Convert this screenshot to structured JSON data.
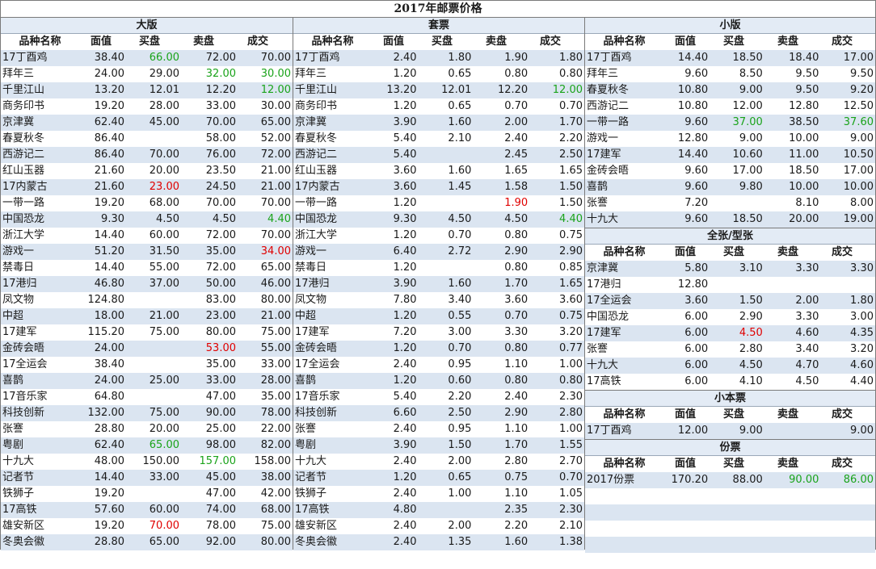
{
  "title": "2017年邮票价格",
  "columns": [
    "品种名称",
    "面值",
    "买盘",
    "卖盘",
    "成交"
  ],
  "colors": {
    "row_alt": "#dbe5f1",
    "header": "#e3ebf5",
    "up": "#1aa31a",
    "down": "#e00000"
  },
  "sections": [
    {
      "key": "dabang",
      "title": "大版",
      "rows": [
        [
          "17丁酉鸡",
          "38.40",
          "66.00",
          "72.00",
          "70.00"
        ],
        [
          "拜年三",
          "24.00",
          "29.00",
          "32.00",
          "30.00"
        ],
        [
          "千里江山",
          "13.20",
          "12.01",
          "12.20",
          "12.00"
        ],
        [
          "商务印书",
          "19.20",
          "28.00",
          "33.00",
          "30.00"
        ],
        [
          "京津冀",
          "62.40",
          "45.00",
          "70.00",
          "65.00"
        ],
        [
          "春夏秋冬",
          "86.40",
          "",
          "58.00",
          "52.00"
        ],
        [
          "西游记二",
          "86.40",
          "70.00",
          "76.00",
          "72.00"
        ],
        [
          "红山玉器",
          "21.60",
          "20.00",
          "23.50",
          "21.00"
        ],
        [
          "17内蒙古",
          "21.60",
          "23.00",
          "24.50",
          "21.00"
        ],
        [
          "一带一路",
          "19.20",
          "68.00",
          "70.00",
          "70.00"
        ],
        [
          "中国恐龙",
          "9.30",
          "4.50",
          "4.50",
          "4.40"
        ],
        [
          "浙江大学",
          "14.40",
          "60.00",
          "72.00",
          "70.00"
        ],
        [
          "游戏一",
          "51.20",
          "31.50",
          "35.00",
          "34.00"
        ],
        [
          "禁毒日",
          "14.40",
          "55.00",
          "72.00",
          "65.00"
        ],
        [
          "17港归",
          "46.80",
          "37.00",
          "50.00",
          "46.00"
        ],
        [
          "凤文物",
          "124.80",
          "",
          "83.00",
          "80.00"
        ],
        [
          "中超",
          "18.00",
          "21.00",
          "23.00",
          "21.00"
        ],
        [
          "17建军",
          "115.20",
          "75.00",
          "80.00",
          "75.00"
        ],
        [
          "金砖会晤",
          "24.00",
          "",
          "53.00",
          "55.00"
        ],
        [
          "17全运会",
          "38.40",
          "",
          "35.00",
          "33.00"
        ],
        [
          "喜鹊",
          "24.00",
          "25.00",
          "33.00",
          "28.00"
        ],
        [
          "17音乐家",
          "64.80",
          "",
          "47.00",
          "35.00"
        ],
        [
          "科技创新",
          "132.00",
          "75.00",
          "90.00",
          "78.00"
        ],
        [
          "张謇",
          "28.80",
          "20.00",
          "25.00",
          "22.00"
        ],
        [
          "粤剧",
          "62.40",
          "65.00",
          "98.00",
          "82.00"
        ],
        [
          "十九大",
          "48.00",
          "150.00",
          "157.00",
          "158.00"
        ],
        [
          "记者节",
          "14.40",
          "33.00",
          "45.00",
          "38.00"
        ],
        [
          "铁狮子",
          "19.20",
          "",
          "47.00",
          "42.00"
        ],
        [
          "17高铁",
          "57.60",
          "60.00",
          "74.00",
          "68.00"
        ],
        [
          "雄安新区",
          "19.20",
          "70.00",
          "78.00",
          "75.00"
        ],
        [
          "冬奥会徽",
          "28.80",
          "65.00",
          "92.00",
          "80.00"
        ]
      ]
    },
    {
      "key": "taopiao",
      "title": "套票",
      "rows": [
        [
          "17丁酉鸡",
          "2.40",
          "1.80",
          "1.90",
          "1.80"
        ],
        [
          "拜年三",
          "1.20",
          "0.65",
          "0.80",
          "0.80"
        ],
        [
          "千里江山",
          "13.20",
          "12.01",
          "12.20",
          "12.00"
        ],
        [
          "商务印书",
          "1.20",
          "0.65",
          "0.70",
          "0.70"
        ],
        [
          "京津冀",
          "3.90",
          "1.60",
          "2.00",
          "1.70"
        ],
        [
          "春夏秋冬",
          "5.40",
          "2.10",
          "2.40",
          "2.20"
        ],
        [
          "西游记二",
          "5.40",
          "",
          "2.45",
          "2.50"
        ],
        [
          "红山玉器",
          "3.60",
          "1.60",
          "1.65",
          "1.65"
        ],
        [
          "17内蒙古",
          "3.60",
          "1.45",
          "1.58",
          "1.50"
        ],
        [
          "一带一路",
          "1.20",
          "",
          "1.90",
          "1.50"
        ],
        [
          "中国恐龙",
          "9.30",
          "4.50",
          "4.50",
          "4.40"
        ],
        [
          "浙江大学",
          "1.20",
          "0.70",
          "0.80",
          "0.75"
        ],
        [
          "游戏一",
          "6.40",
          "2.72",
          "2.90",
          "2.90"
        ],
        [
          "禁毒日",
          "1.20",
          "",
          "0.80",
          "0.85"
        ],
        [
          "17港归",
          "3.90",
          "1.60",
          "1.70",
          "1.65"
        ],
        [
          "凤文物",
          "7.80",
          "3.40",
          "3.60",
          "3.60"
        ],
        [
          "中超",
          "1.20",
          "0.55",
          "0.70",
          "0.75"
        ],
        [
          "17建军",
          "7.20",
          "3.00",
          "3.30",
          "3.20"
        ],
        [
          "金砖会晤",
          "1.20",
          "0.70",
          "0.80",
          "0.77"
        ],
        [
          "17全运会",
          "2.40",
          "0.95",
          "1.10",
          "1.00"
        ],
        [
          "喜鹊",
          "1.20",
          "0.60",
          "0.80",
          "0.80"
        ],
        [
          "17音乐家",
          "5.40",
          "2.20",
          "2.40",
          "2.30"
        ],
        [
          "科技创新",
          "6.60",
          "2.50",
          "2.90",
          "2.80"
        ],
        [
          "张謇",
          "2.40",
          "0.95",
          "1.10",
          "1.00"
        ],
        [
          "粤剧",
          "3.90",
          "1.50",
          "1.70",
          "1.55"
        ],
        [
          "十九大",
          "2.40",
          "2.00",
          "2.80",
          "2.70"
        ],
        [
          "记者节",
          "1.20",
          "0.65",
          "0.75",
          "0.70"
        ],
        [
          "铁狮子",
          "2.40",
          "1.00",
          "1.10",
          "1.05"
        ],
        [
          "17高铁",
          "4.80",
          "",
          "2.35",
          "2.30"
        ],
        [
          "雄安新区",
          "2.40",
          "2.00",
          "2.20",
          "2.10"
        ],
        [
          "冬奥会徽",
          "2.40",
          "1.35",
          "1.60",
          "1.38"
        ]
      ]
    },
    {
      "key": "xiaoban",
      "title": "小版",
      "rows": [
        [
          "17丁酉鸡",
          "14.40",
          "18.50",
          "18.40",
          "17.00"
        ],
        [
          "拜年三",
          "9.60",
          "8.50",
          "9.50",
          "9.50"
        ],
        [
          "春夏秋冬",
          "10.80",
          "9.00",
          "9.50",
          "9.20"
        ],
        [
          "西游记二",
          "10.80",
          "12.00",
          "12.80",
          "12.50"
        ],
        [
          "一带一路",
          "9.60",
          "37.00",
          "38.50",
          "37.60"
        ],
        [
          "游戏一",
          "12.80",
          "9.00",
          "10.00",
          "9.00"
        ],
        [
          "17建军",
          "14.40",
          "10.60",
          "11.00",
          "10.50"
        ],
        [
          "金砖会晤",
          "9.60",
          "17.00",
          "18.50",
          "17.00"
        ],
        [
          "喜鹊",
          "9.60",
          "9.80",
          "10.00",
          "10.00"
        ],
        [
          "张謇",
          "7.20",
          "",
          "8.10",
          "8.00"
        ],
        [
          "十九大",
          "9.60",
          "18.50",
          "20.00",
          "19.00"
        ]
      ]
    },
    {
      "key": "quanzhang",
      "title": "全张/型张",
      "rows": [
        [
          "京津冀",
          "5.80",
          "3.10",
          "3.30",
          "3.30"
        ],
        [
          "17港归",
          "12.80",
          "",
          "",
          ""
        ],
        [
          "17全运会",
          "3.60",
          "1.50",
          "2.00",
          "1.80"
        ],
        [
          "中国恐龙",
          "6.00",
          "2.90",
          "3.30",
          "3.00"
        ],
        [
          "17建军",
          "6.00",
          "4.50",
          "4.60",
          "4.35"
        ],
        [
          "张謇",
          "6.00",
          "2.80",
          "3.40",
          "3.20"
        ],
        [
          "十九大",
          "6.00",
          "4.50",
          "4.70",
          "4.60"
        ],
        [
          "17高铁",
          "6.00",
          "4.10",
          "4.50",
          "4.40"
        ]
      ]
    },
    {
      "key": "xiaobenpiao",
      "title": "小本票",
      "rows": [
        [
          "17丁酉鸡",
          "12.00",
          "9.00",
          "",
          "9.00"
        ]
      ]
    },
    {
      "key": "fenpiao",
      "title": "份票",
      "rows": [
        [
          "2017份票",
          "170.20",
          "88.00",
          "90.00",
          "86.00"
        ]
      ]
    }
  ],
  "highlights": [
    {
      "section": "dabang",
      "row": 0,
      "col": 2,
      "color": "green"
    },
    {
      "section": "dabang",
      "row": 1,
      "col": 3,
      "color": "green"
    },
    {
      "section": "dabang",
      "row": 1,
      "col": 4,
      "color": "green"
    },
    {
      "section": "dabang",
      "row": 2,
      "col": 4,
      "color": "green"
    },
    {
      "section": "dabang",
      "row": 8,
      "col": 2,
      "color": "red"
    },
    {
      "section": "dabang",
      "row": 10,
      "col": 4,
      "color": "green"
    },
    {
      "section": "dabang",
      "row": 12,
      "col": 4,
      "color": "red"
    },
    {
      "section": "dabang",
      "row": 18,
      "col": 3,
      "color": "red"
    },
    {
      "section": "dabang",
      "row": 24,
      "col": 2,
      "color": "green"
    },
    {
      "section": "dabang",
      "row": 25,
      "col": 3,
      "color": "green"
    },
    {
      "section": "dabang",
      "row": 29,
      "col": 2,
      "color": "red"
    },
    {
      "section": "taopiao",
      "row": 2,
      "col": 4,
      "color": "green"
    },
    {
      "section": "taopiao",
      "row": 9,
      "col": 3,
      "color": "red"
    },
    {
      "section": "taopiao",
      "row": 10,
      "col": 4,
      "color": "green"
    },
    {
      "section": "xiaoban",
      "row": 4,
      "col": 2,
      "color": "green"
    },
    {
      "section": "xiaoban",
      "row": 4,
      "col": 4,
      "color": "green"
    },
    {
      "section": "quanzhang",
      "row": 4,
      "col": 2,
      "color": "red"
    },
    {
      "section": "fenpiao",
      "row": 0,
      "col": 3,
      "color": "green"
    },
    {
      "section": "fenpiao",
      "row": 0,
      "col": 4,
      "color": "green"
    }
  ]
}
